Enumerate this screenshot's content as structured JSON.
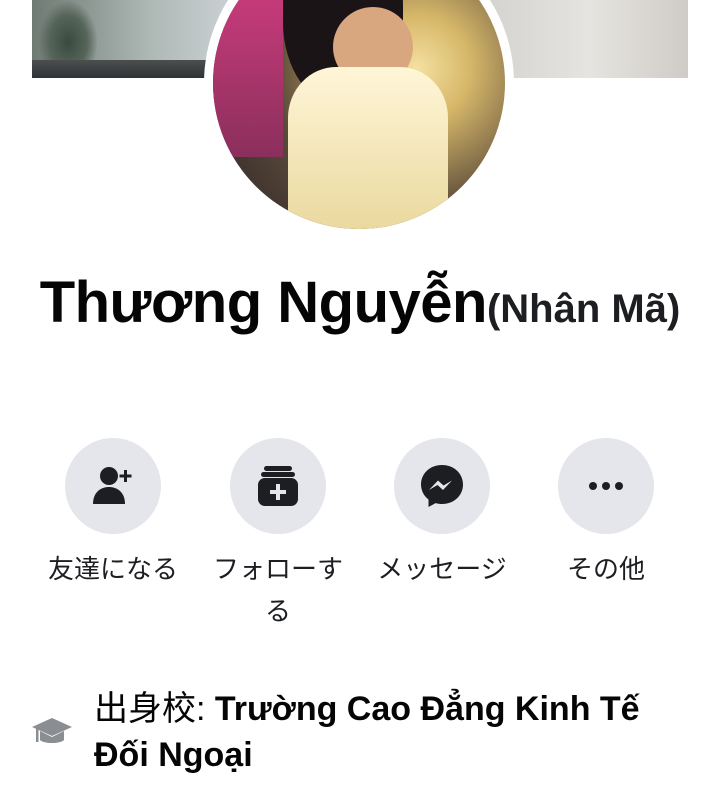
{
  "profile": {
    "name": "Thương Nguyễn",
    "alternate_name": "(Nhân Mã)"
  },
  "actions": [
    {
      "label": "友達になる",
      "icon": "add-friend-icon"
    },
    {
      "label": "フォローする",
      "icon": "follow-icon"
    },
    {
      "label": "メッセージ",
      "icon": "messenger-icon"
    },
    {
      "label": "その他",
      "icon": "more-icon"
    }
  ],
  "education": {
    "prefix": "出身校:",
    "school": "Trường Cao Đẳng Kinh Tế Đối Ngoại",
    "icon": "graduation-cap-icon"
  },
  "colors": {
    "button_bg": "#e4e6eb",
    "icon": "#1c1e21",
    "edu_icon": "#8a8d91"
  }
}
